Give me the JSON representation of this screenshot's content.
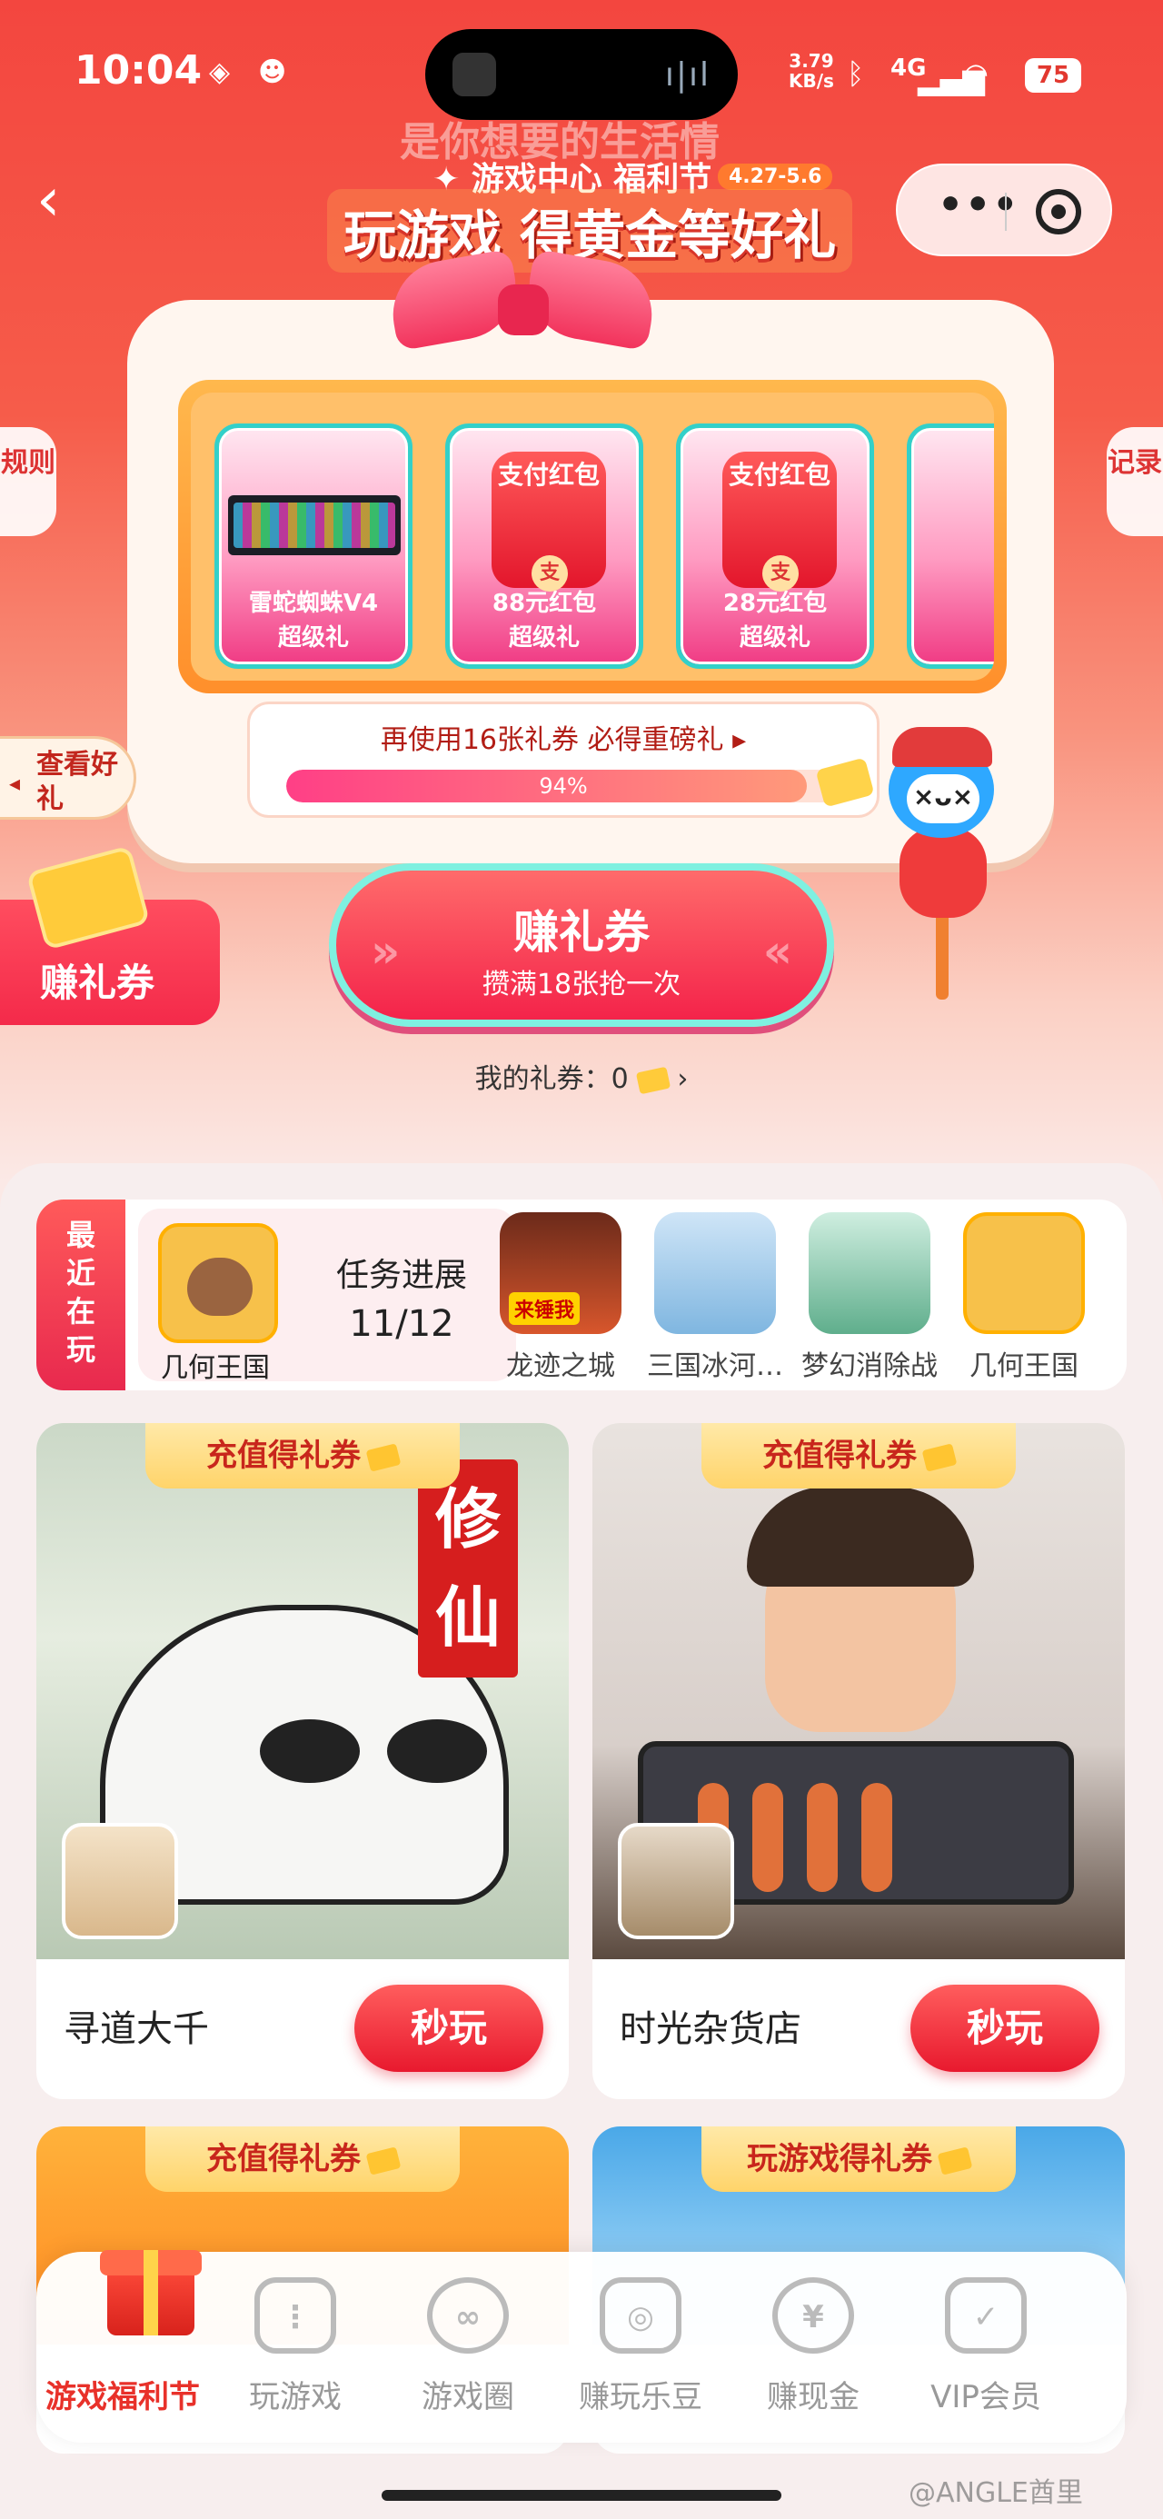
{
  "status": {
    "time": "10:04",
    "net_speed_value": "3.79",
    "net_speed_unit": "KB/s",
    "network": "4G",
    "battery": "75"
  },
  "header": {
    "faint_banner": "是你想要的生活情",
    "festival": "✦ 游戏中心 福利节",
    "festival_dates": "4.27-5.6",
    "headline": "玩游戏 得黄金等好礼",
    "more_label": "•••"
  },
  "side": {
    "rules": "规则",
    "records": "记录",
    "check_gifts": "查看好礼"
  },
  "machine": {
    "prizes": [
      {
        "label1": "雷蛇蜘蛛V4",
        "label2": "超级礼"
      },
      {
        "pay": "支付红包",
        "coin": "支",
        "label1": "88元红包",
        "label2": "超级礼"
      },
      {
        "pay": "支付红包",
        "coin": "支",
        "label1": "28元红包",
        "label2": "超级礼"
      }
    ],
    "progress_text": "再使用16张礼券 必得重磅礼 ▸",
    "progress_percent": 94,
    "progress_label": "94%",
    "mascot_face": "×ᴗ×"
  },
  "earn": {
    "side_label": "赚礼券",
    "button_title": "赚礼券",
    "button_sub": "攒满18张抢一次",
    "my_tickets": "我的礼券：0",
    "my_tickets_arrow": "›"
  },
  "recent": {
    "tag": "最近在玩",
    "task_game": "几何王国",
    "task_title": "任务进展",
    "task_value": "11/12",
    "games": [
      {
        "name": "龙迹之城",
        "badge": "来锤我",
        "color": "#c0492a"
      },
      {
        "name": "三国冰河…",
        "color": "#7fb6e0"
      },
      {
        "name": "梦幻消除战",
        "color": "#5fae8c"
      },
      {
        "name": "几何王国",
        "color": "#f7c14a"
      }
    ]
  },
  "cards": [
    {
      "tag": "充值得礼券",
      "title": "寻道大千",
      "play": "秒玩",
      "art_text": "修仙"
    },
    {
      "tag": "充值得礼券",
      "title": "时光杂货店",
      "play": "秒玩"
    },
    {
      "tag": "充值得礼券"
    },
    {
      "tag": "玩游戏得礼券"
    }
  ],
  "nav": [
    {
      "label": "游戏福利节",
      "icon": "gift-icon",
      "active": true
    },
    {
      "label": "玩游戏",
      "icon": "controller-icon",
      "glyph": "⋮"
    },
    {
      "label": "游戏圈",
      "icon": "circle-icon",
      "glyph": "∞"
    },
    {
      "label": "赚玩乐豆",
      "icon": "bean-icon",
      "glyph": "◎"
    },
    {
      "label": "赚现金",
      "icon": "yuan-icon",
      "glyph": "¥"
    },
    {
      "label": "VIP会员",
      "icon": "vip-icon",
      "glyph": "✓"
    }
  ],
  "watermark": "@ANGLE酋里"
}
